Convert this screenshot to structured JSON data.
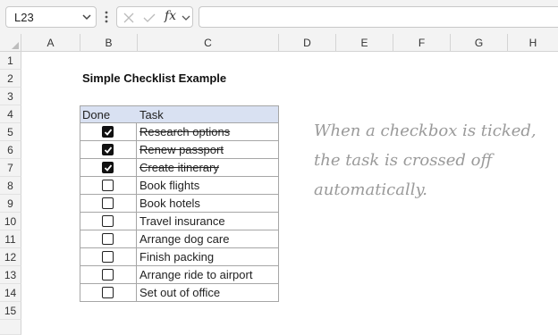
{
  "formula_bar": {
    "name_box": "L23",
    "fx_label": "fx",
    "formula_value": ""
  },
  "columns": [
    "A",
    "B",
    "C",
    "D",
    "E",
    "F",
    "G",
    "H"
  ],
  "rows": [
    "1",
    "2",
    "3",
    "4",
    "5",
    "6",
    "7",
    "8",
    "9",
    "10",
    "11",
    "12",
    "13",
    "14",
    "15"
  ],
  "title": "Simple Checklist Example",
  "table": {
    "headers": {
      "done": "Done",
      "task": "Task"
    },
    "tasks": [
      {
        "task": "Research options",
        "done": true
      },
      {
        "task": "Renew passport",
        "done": true
      },
      {
        "task": "Create itinerary",
        "done": true
      },
      {
        "task": "Book flights",
        "done": false
      },
      {
        "task": "Book hotels",
        "done": false
      },
      {
        "task": "Travel insurance",
        "done": false
      },
      {
        "task": "Arrange dog care",
        "done": false
      },
      {
        "task": "Finish packing",
        "done": false
      },
      {
        "task": "Arrange ride to airport",
        "done": false
      },
      {
        "task": "Set out of office",
        "done": false
      }
    ]
  },
  "note": "When a checkbox is ticked, the task is crossed off automatically."
}
